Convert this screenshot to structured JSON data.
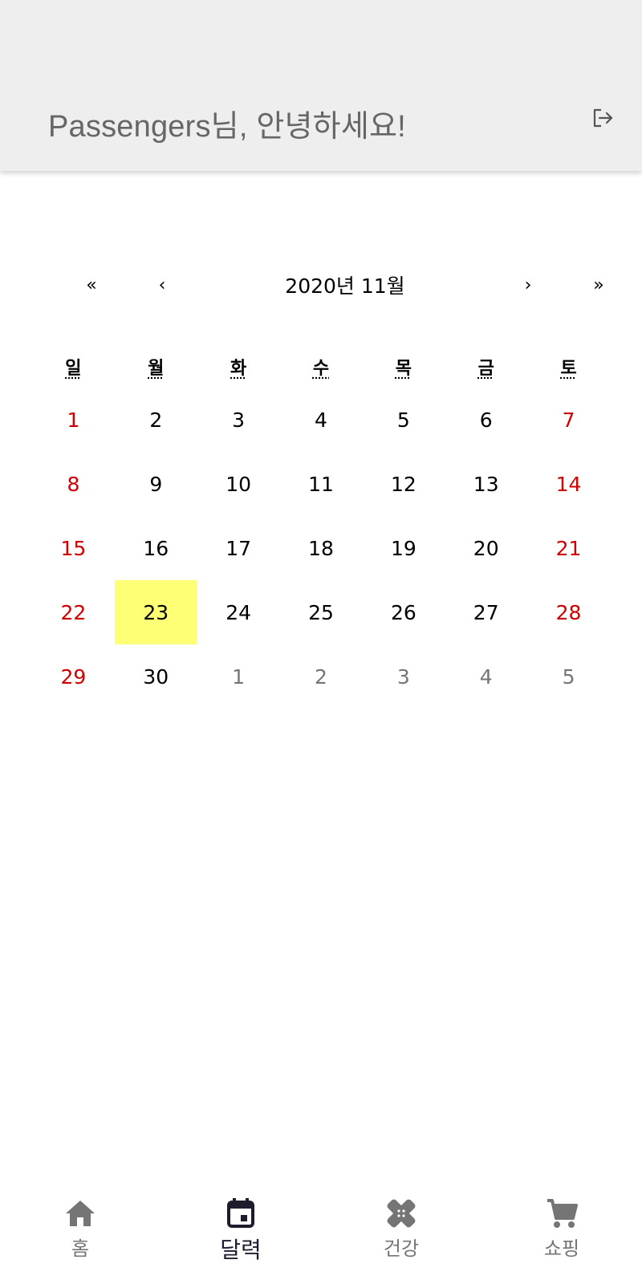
{
  "header": {
    "greeting": "Passengers님, 안녕하세요!",
    "logout_icon": "logout-icon"
  },
  "calendar": {
    "nav": {
      "first": "«",
      "prev": "‹",
      "label": "2020년 11월",
      "next": "›",
      "last": "»"
    },
    "weekdays": [
      "일",
      "월",
      "화",
      "수",
      "목",
      "금",
      "토"
    ],
    "days": [
      {
        "d": "1",
        "t": "weekend"
      },
      {
        "d": "2",
        "t": ""
      },
      {
        "d": "3",
        "t": ""
      },
      {
        "d": "4",
        "t": ""
      },
      {
        "d": "5",
        "t": ""
      },
      {
        "d": "6",
        "t": ""
      },
      {
        "d": "7",
        "t": "weekend"
      },
      {
        "d": "8",
        "t": "weekend"
      },
      {
        "d": "9",
        "t": ""
      },
      {
        "d": "10",
        "t": ""
      },
      {
        "d": "11",
        "t": ""
      },
      {
        "d": "12",
        "t": ""
      },
      {
        "d": "13",
        "t": ""
      },
      {
        "d": "14",
        "t": "weekend"
      },
      {
        "d": "15",
        "t": "weekend"
      },
      {
        "d": "16",
        "t": ""
      },
      {
        "d": "17",
        "t": ""
      },
      {
        "d": "18",
        "t": ""
      },
      {
        "d": "19",
        "t": ""
      },
      {
        "d": "20",
        "t": ""
      },
      {
        "d": "21",
        "t": "weekend"
      },
      {
        "d": "22",
        "t": "weekend"
      },
      {
        "d": "23",
        "t": "today"
      },
      {
        "d": "24",
        "t": ""
      },
      {
        "d": "25",
        "t": ""
      },
      {
        "d": "26",
        "t": ""
      },
      {
        "d": "27",
        "t": ""
      },
      {
        "d": "28",
        "t": "weekend"
      },
      {
        "d": "29",
        "t": "weekend"
      },
      {
        "d": "30",
        "t": ""
      },
      {
        "d": "1",
        "t": "neighbor"
      },
      {
        "d": "2",
        "t": "neighbor"
      },
      {
        "d": "3",
        "t": "neighbor"
      },
      {
        "d": "4",
        "t": "neighbor"
      },
      {
        "d": "5",
        "t": "neighbor"
      }
    ]
  },
  "bottom_nav": {
    "tabs": [
      {
        "label": "홈",
        "icon": "home-icon",
        "active": false
      },
      {
        "label": "달력",
        "icon": "calendar-icon",
        "active": true
      },
      {
        "label": "건강",
        "icon": "bandage-icon",
        "active": false
      },
      {
        "label": "쇼핑",
        "icon": "cart-icon",
        "active": false
      }
    ]
  },
  "colors": {
    "header_bg": "#eeeeee",
    "weekend": "#d10000",
    "neighbor_month": "#757575",
    "today_highlight": "#ffff76",
    "active_tab": "#1c1c2e",
    "inactive_tab": "#757575"
  }
}
